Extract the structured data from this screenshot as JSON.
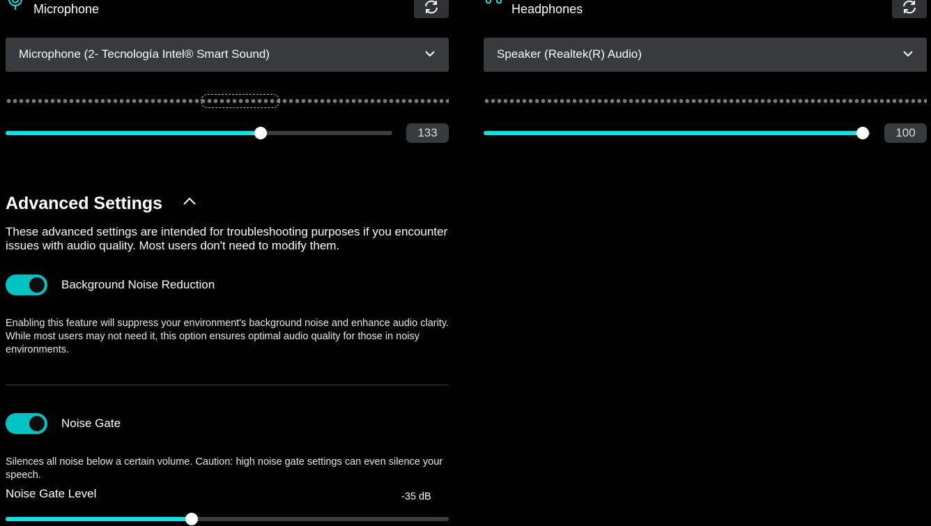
{
  "colors": {
    "accent": "#00e5e5",
    "toggle_on": "#00c4c4",
    "panel": "#373b3b"
  },
  "microphone": {
    "title": "Microphone",
    "icon": "microphone-icon",
    "device": "Microphone (2- Tecnología Intel® Smart Sound)",
    "volume": 133,
    "volume_fraction": 0.66,
    "meter_highlight_range": [
      0.44,
      0.62
    ]
  },
  "headphones": {
    "title": "Headphones",
    "icon": "headphones-icon",
    "device": "Speaker (Realtek(R) Audio)",
    "volume": 100,
    "volume_fraction": 0.98
  },
  "advanced": {
    "title": "Advanced Settings",
    "description": "These advanced settings are intended for troubleshooting purposes if you encounter issues with audio quality. Most users don't need to modify them.",
    "noise_reduction": {
      "label": "Background Noise Reduction",
      "enabled": true,
      "description": "Enabling this feature will suppress your environment's background noise and enhance audio clarity. While most users may not need it, this option ensures optimal audio quality for those in noisy environments."
    },
    "noise_gate": {
      "label": "Noise Gate",
      "enabled": true,
      "description": "Silences all noise below a certain volume. Caution: high noise gate settings can even silence your speech.",
      "level_label": "Noise Gate Level",
      "level_value": "-35 dB",
      "level_fraction": 0.42
    }
  }
}
